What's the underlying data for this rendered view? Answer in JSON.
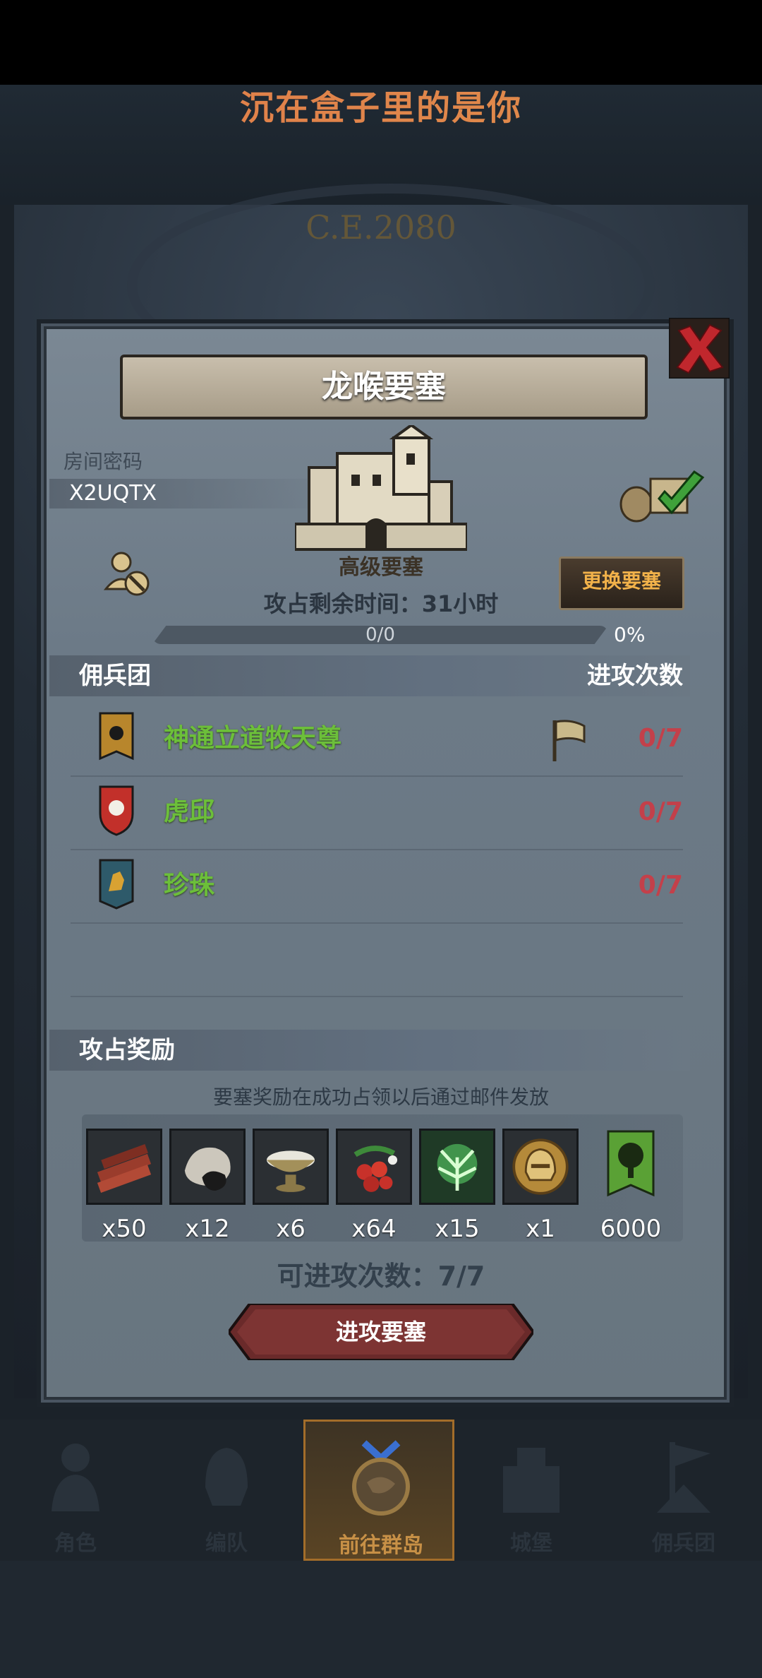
{
  "app": {
    "title": "沉在盒子里的是你",
    "era": "C.E.2080"
  },
  "dialog": {
    "title": "龙喉要塞",
    "room_password_label": "房间密码",
    "room_password": "X2UQTX",
    "fortress_type": "高级要塞",
    "change_button": "更换要塞",
    "remaining_time": "攻占剩余时间：31小时",
    "progress": {
      "text": "0/0",
      "percent_label": "0%",
      "value": 0
    },
    "mercenary_header": {
      "left": "佣兵团",
      "right": "进攻次数"
    },
    "mercenaries": [
      {
        "name": "神通立道牧天尊",
        "attacks": "0/7",
        "banner_color": "#b8862c",
        "has_flag": true
      },
      {
        "name": "虎邱",
        "attacks": "0/7",
        "banner_color": "#c2302a",
        "has_flag": false
      },
      {
        "name": "珍珠",
        "attacks": "0/7",
        "banner_color": "#2e5a6a",
        "has_flag": false
      }
    ],
    "reward_header": "攻占奖励",
    "reward_note": "要塞奖励在成功占领以后通过邮件发放",
    "rewards": [
      {
        "icon": "wood-planks-icon",
        "qty": "x50"
      },
      {
        "icon": "ore-rock-icon",
        "qty": "x12"
      },
      {
        "icon": "salt-bowl-icon",
        "qty": "x6"
      },
      {
        "icon": "berries-icon",
        "qty": "x64"
      },
      {
        "icon": "green-herb-icon",
        "qty": "x15"
      },
      {
        "icon": "golden-helmet-icon",
        "qty": "x1"
      },
      {
        "icon": "tree-banner-icon",
        "qty": "6000"
      }
    ],
    "attack_count": "可进攻次数：7/7",
    "attack_button": "进攻要塞"
  },
  "nav": [
    {
      "label": "角色",
      "active": false
    },
    {
      "label": "编队",
      "active": false
    },
    {
      "label": "前往群岛",
      "active": true
    },
    {
      "label": "城堡",
      "active": false
    },
    {
      "label": "佣兵团",
      "active": false
    }
  ],
  "colors": {
    "merc_name": "#6cbf3a",
    "attack_red": "#c3404a",
    "gold": "#f2b24a"
  }
}
